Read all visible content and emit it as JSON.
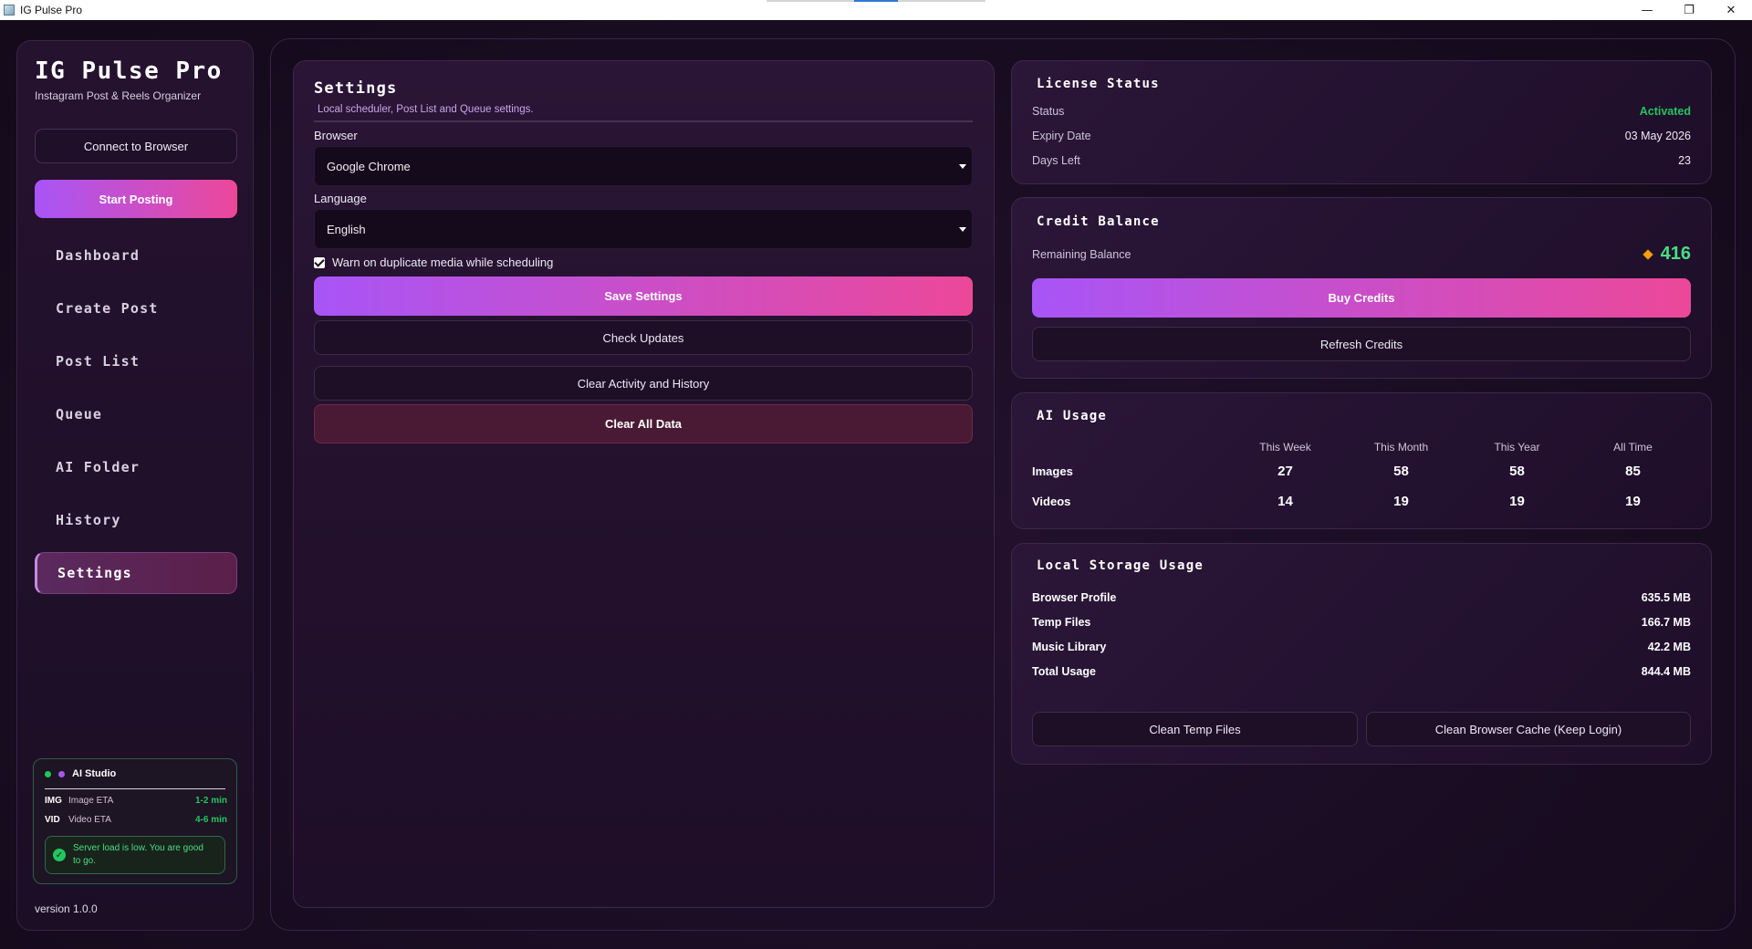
{
  "window": {
    "title": "IG Pulse Pro",
    "controls": {
      "minimize": "—",
      "restore": "❐",
      "close": "✕"
    }
  },
  "sidebar": {
    "brand_title": "IG Pulse Pro",
    "brand_subtitle": "Instagram Post & Reels Organizer",
    "connect_label": "Connect to Browser",
    "start_label": "Start Posting",
    "nav": [
      {
        "label": "Dashboard",
        "active": false
      },
      {
        "label": "Create Post",
        "active": false
      },
      {
        "label": "Post List",
        "active": false
      },
      {
        "label": "Queue",
        "active": false
      },
      {
        "label": "AI Folder",
        "active": false
      },
      {
        "label": "History",
        "active": false
      },
      {
        "label": "Settings",
        "active": true
      }
    ],
    "ai_studio": {
      "title": "AI Studio",
      "image_tag": "IMG",
      "image_label": "Image ETA",
      "image_eta": "1-2 min",
      "video_tag": "VID",
      "video_label": "Video ETA",
      "video_eta": "4-6 min",
      "note": "Server load is low. You are good to go."
    },
    "version": "version 1.0.0"
  },
  "settings": {
    "title": "Settings",
    "subtitle": "Local scheduler, Post List and Queue settings.",
    "browser_label": "Browser",
    "browser_value": "Google Chrome",
    "language_label": "Language",
    "language_value": "English",
    "warn_duplicate_label": "Warn on duplicate media while scheduling",
    "warn_duplicate_checked": true,
    "save_label": "Save Settings",
    "check_updates_label": "Check Updates",
    "clear_activity_label": "Clear Activity and History",
    "clear_all_label": "Clear All Data"
  },
  "license": {
    "title": "License Status",
    "status_label": "Status",
    "status_value": "Activated",
    "expiry_label": "Expiry Date",
    "expiry_value": "03 May 2026",
    "days_label": "Days Left",
    "days_value": "23"
  },
  "credit": {
    "title": "Credit Balance",
    "remaining_label": "Remaining Balance",
    "remaining_value": "416",
    "buy_label": "Buy Credits",
    "refresh_label": "Refresh Credits"
  },
  "ai_usage": {
    "title": "AI Usage",
    "columns": [
      "This Week",
      "This Month",
      "This Year",
      "All Time"
    ],
    "rows": [
      {
        "name": "Images",
        "values": [
          "27",
          "58",
          "58",
          "85"
        ]
      },
      {
        "name": "Videos",
        "values": [
          "14",
          "19",
          "19",
          "19"
        ]
      }
    ]
  },
  "storage": {
    "title": "Local Storage Usage",
    "items": [
      {
        "label": "Browser Profile",
        "value": "635.5 MB"
      },
      {
        "label": "Temp Files",
        "value": "166.7 MB"
      },
      {
        "label": "Music Library",
        "value": "42.2 MB"
      },
      {
        "label": "Total Usage",
        "value": "844.4 MB"
      }
    ],
    "clean_temp_label": "Clean Temp Files",
    "clean_cache_label": "Clean Browser Cache (Keep Login)"
  },
  "colors": {
    "accent_start": "#a855f7",
    "accent_end": "#ec4899",
    "success": "#22c55e",
    "background": "#150a1c"
  }
}
